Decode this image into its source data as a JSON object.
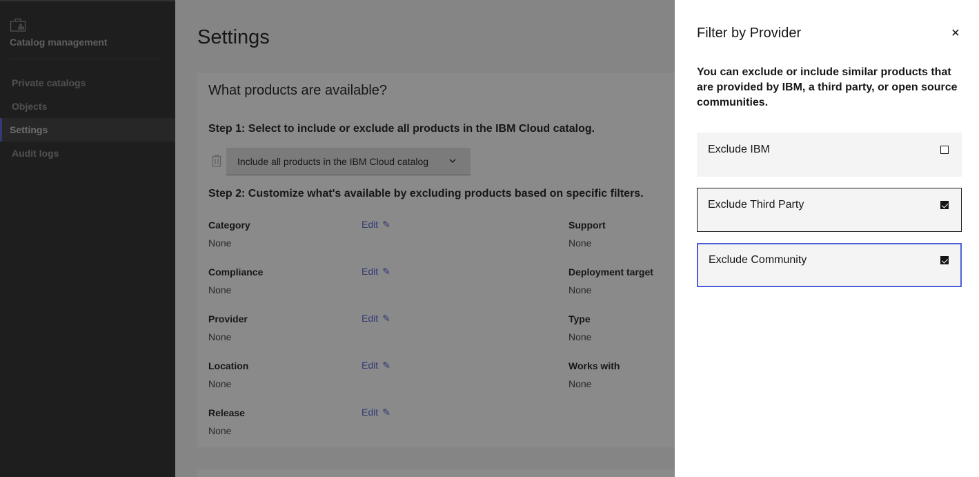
{
  "sidebar": {
    "title": "Catalog management",
    "items": [
      {
        "label": "Private catalogs"
      },
      {
        "label": "Objects"
      },
      {
        "label": "Settings"
      },
      {
        "label": "Audit logs"
      }
    ]
  },
  "main": {
    "title": "Settings",
    "card_title": "What products are available?",
    "step1": "Step 1: Select to include or exclude all products in the IBM Cloud catalog.",
    "dropdown_value": "Include all products in the IBM Cloud catalog",
    "step2": "Step 2: Customize what's available by excluding products based on specific filters.",
    "edit_label": "Edit",
    "filters_left": [
      {
        "label": "Category",
        "value": "None"
      },
      {
        "label": "Compliance",
        "value": "None"
      },
      {
        "label": "Provider",
        "value": "None"
      },
      {
        "label": "Location",
        "value": "None"
      },
      {
        "label": "Release",
        "value": "None"
      }
    ],
    "filters_right": [
      {
        "label": "Support",
        "value": "None"
      },
      {
        "label": "Deployment target",
        "value": "None"
      },
      {
        "label": "Type",
        "value": "None"
      },
      {
        "label": "Works with",
        "value": "None"
      }
    ]
  },
  "panel": {
    "title": "Filter by Provider",
    "close_glyph": "✕",
    "description": "You can exclude or include similar products that are provided by IBM, a third party, or open source communities.",
    "options": [
      {
        "label": "Exclude IBM",
        "checked": false
      },
      {
        "label": "Exclude Third Party",
        "checked": true
      },
      {
        "label": "Exclude Community",
        "checked": true
      }
    ]
  },
  "colors": {
    "accent": "#4d5fd6",
    "sidebar_bg": "#262626",
    "link": "#4d5fd6"
  }
}
